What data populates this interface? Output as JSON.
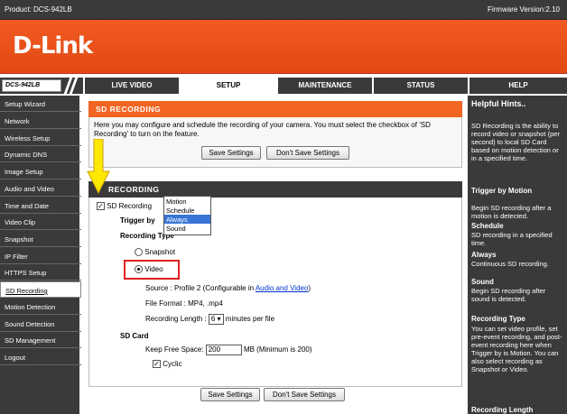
{
  "topbar": {
    "product": "Product: DCS-942LB",
    "firmware": "Firmware Version:2.10"
  },
  "brand": {
    "logo": "D-Link",
    "color": "#f15a22"
  },
  "nav": {
    "model": "DCS-942LB",
    "tabs": [
      "LIVE VIDEO",
      "SETUP",
      "MAINTENANCE",
      "STATUS",
      "HELP"
    ],
    "active_tab": "SETUP"
  },
  "sidebar": {
    "items": [
      "Setup Wizard",
      "Network",
      "Wireless Setup",
      "Dynamic DNS",
      "Image Setup",
      "Audio and Video",
      "Time and Date",
      "Video Clip",
      "Snapshot",
      "IP Filter",
      "HTTPS Setup",
      "SD Recording",
      "Motion Detection",
      "Sound Detection",
      "SD Management",
      "Logout"
    ],
    "selected": "SD Recording"
  },
  "sd_panel": {
    "title": "SD RECORDING",
    "description": "Here you may configure and schedule the recording of your camera. You must select the checkbox of 'SD Recording' to turn on the feature.",
    "save_label": "Save Settings",
    "dont_save_label": "Don't Save Settings"
  },
  "recording": {
    "title": "RECORDING",
    "sd_recording_label": "SD Recording",
    "trigger_by_label": "Trigger by",
    "trigger_options": [
      "Motion",
      "Schedule",
      "Always",
      "Sound"
    ],
    "trigger_selected": "Always",
    "recording_type_label": "Recording Type",
    "snapshot_label": "Snapshot",
    "video_label": "Video",
    "source_label": "Source : Profile 2  (Configurable in ",
    "source_link": "Audio and Video",
    "source_end": ")",
    "file_format": "File Format :  MP4, .mp4",
    "recording_length_label": "Recording Length :",
    "recording_length_value": "6",
    "recording_length_unit": "minutes per file",
    "sd_card_label": "SD Card",
    "keep_free_label": "Keep Free Space:",
    "keep_free_value": "200",
    "keep_free_unit": "MB (Minimum is 200)",
    "cyclic_label": "Cyclic"
  },
  "hints": {
    "title": "Helpful Hints..",
    "intro": "SD Recording is the ability to record video or snapshot (per second) to local SD Card based on motion detection or in a specified time.",
    "trigger_head": "Trigger by Motion",
    "trigger_motion": "Begin SD recording after a motion is detected.",
    "schedule_head": "Schedule",
    "schedule_text": "SD recording in a specified time.",
    "always_head": "Always",
    "always_text": "Continuous SD recording.",
    "sound_head": "Sound",
    "sound_text": "Begin SD recording after sound is detected.",
    "rectype_head": "Recording Type",
    "rectype_text": "You can set video profile, set pre-event recording, and post-event recording here when Trigger by is Motion. You can also select recording as Snapshot or Video.",
    "reclen_head": "Recording Length"
  }
}
